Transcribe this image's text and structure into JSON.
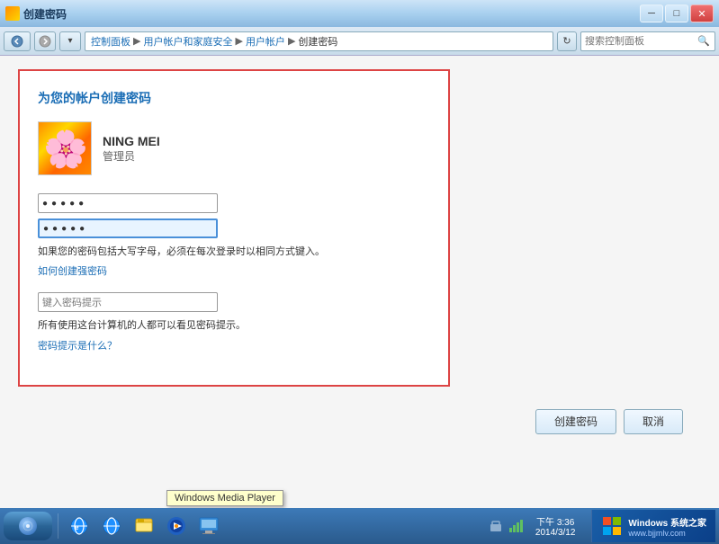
{
  "window": {
    "title": "创建密码",
    "controls": {
      "minimize": "─",
      "maximize": "□",
      "close": "✕"
    }
  },
  "address_bar": {
    "back_btn": "◀",
    "forward_btn": "▶",
    "breadcrumb": {
      "part1": "控制面板",
      "part2": "用户帐户和家庭安全",
      "part3": "用户帐户",
      "part4": "创建密码"
    },
    "refresh_btn": "↻",
    "search_placeholder": "搜索控制面板",
    "search_icon": "🔍"
  },
  "form": {
    "title": "为您的帐户创建密码",
    "user": {
      "name": "NING MEI",
      "role": "管理员"
    },
    "password_placeholder": "●●●●●",
    "confirm_placeholder": "●●●●●",
    "hint_text": "如果您的密码包括大写字母，必须在每次登录时以相同方式键入。",
    "create_strong_link": "如何创建强密码",
    "hint_input_placeholder": "键入密码提示",
    "hint_note": "所有使用这台计算机的人都可以看见密码提示。",
    "hint_link": "密码提示是什么？"
  },
  "buttons": {
    "create": "创建密码",
    "cancel": "取消"
  },
  "taskbar": {
    "wmp_label": "Windows Media Player",
    "watermark": "Windows 系统之家",
    "watermark_url": "www.bjjmlv.com"
  }
}
